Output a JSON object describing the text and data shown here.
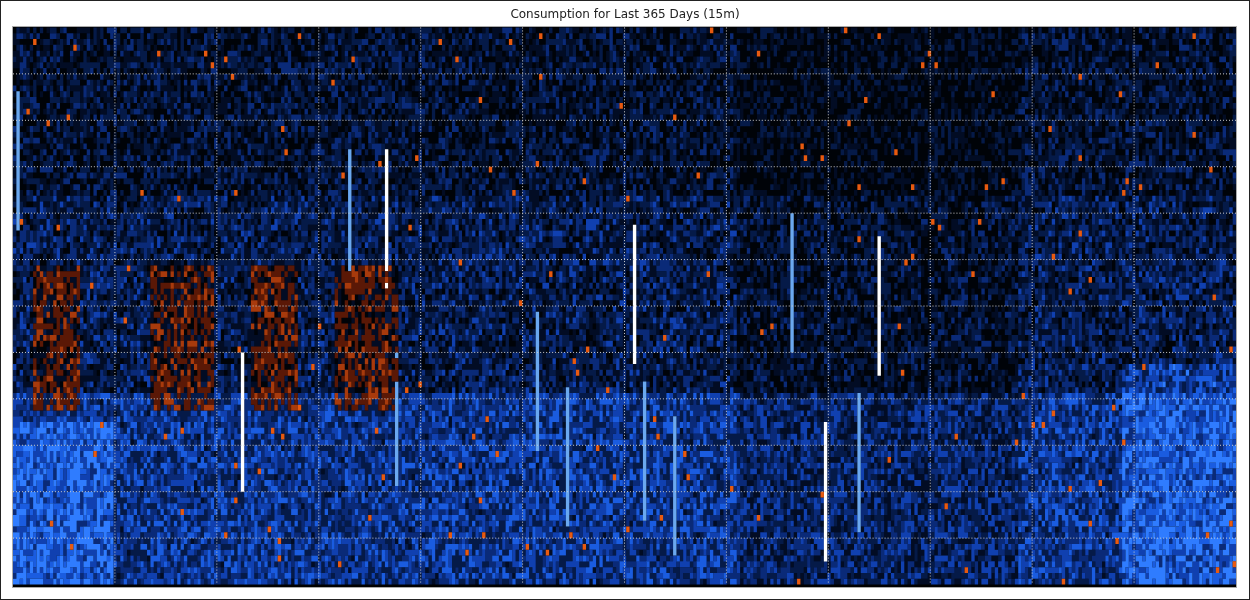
{
  "chart": {
    "title": "Consumption for Last 365 Days (15m)"
  }
}
